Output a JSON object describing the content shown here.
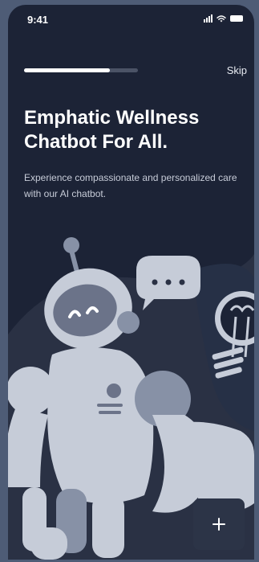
{
  "status_bar": {
    "time": "9:41",
    "icons": [
      "signal-icon",
      "wifi-icon",
      "battery-icon"
    ]
  },
  "onboarding": {
    "progress_fraction": 0.75,
    "skip_label": "Skip",
    "title": "Emphatic Wellness Chatbot For All.",
    "subtitle": "Experience compassionate and personalized care with our AI chatbot."
  },
  "illustration": {
    "elements": [
      "robot",
      "speech-bubble",
      "lightbulb"
    ]
  },
  "fab": {
    "icon": "plus-icon"
  },
  "colors": {
    "background": "#1c2336",
    "robot": "#c6ccd8",
    "accent_dark": "#2c3447"
  }
}
